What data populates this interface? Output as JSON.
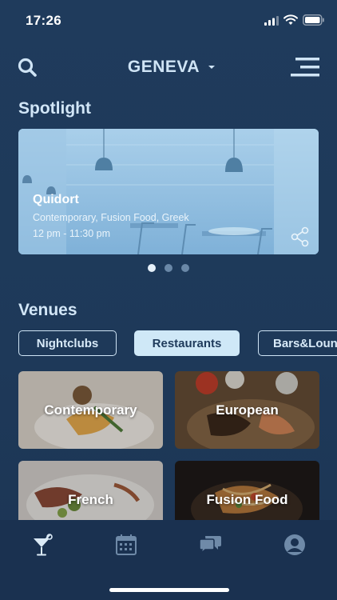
{
  "status": {
    "time": "17:26"
  },
  "header": {
    "city": "GENEVA"
  },
  "spotlight": {
    "title": "Spotlight",
    "name": "Quidort",
    "tags": "Contemporary, Fusion Food, Greek",
    "hours": "12 pm - 11:30 pm",
    "pages": 3,
    "active_page": 1
  },
  "venues": {
    "title": "Venues",
    "filters": [
      "Nightclubs",
      "Restaurants",
      "Bars&Lounges"
    ],
    "active_filter": "Restaurants",
    "categories": [
      "Contemporary",
      "European",
      "French",
      "Fusion Food"
    ]
  },
  "tabbar": {
    "tabs": [
      "venues-tab",
      "events-tab",
      "messages-tab",
      "profile-tab"
    ],
    "active_tab": "venues-tab"
  },
  "colors": {
    "background": "#1e3a5b",
    "accent": "#cfe8f7",
    "tabbar": "#1a3150"
  }
}
